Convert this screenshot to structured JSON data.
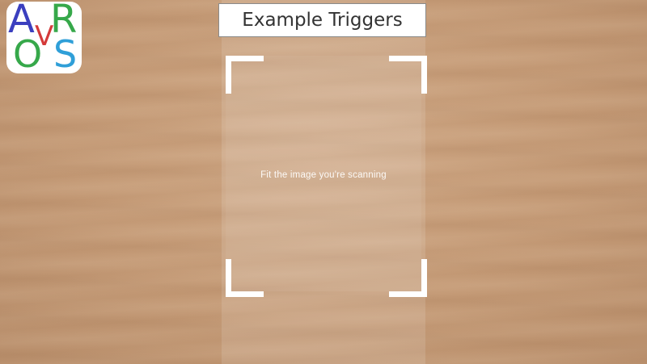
{
  "header": {
    "title_button_label": "Example Triggers"
  },
  "logo": {
    "letters": {
      "a": "A",
      "r": "R",
      "v": "V",
      "o": "O",
      "s": "S"
    },
    "colors": {
      "a": "#3b3fbf",
      "r": "#36a84a",
      "v": "#d43a3a",
      "o": "#36a84a",
      "s": "#2f9fd8"
    }
  },
  "scanner": {
    "hint": "Fit the image you're scanning",
    "frame_color": "#ffffff"
  }
}
